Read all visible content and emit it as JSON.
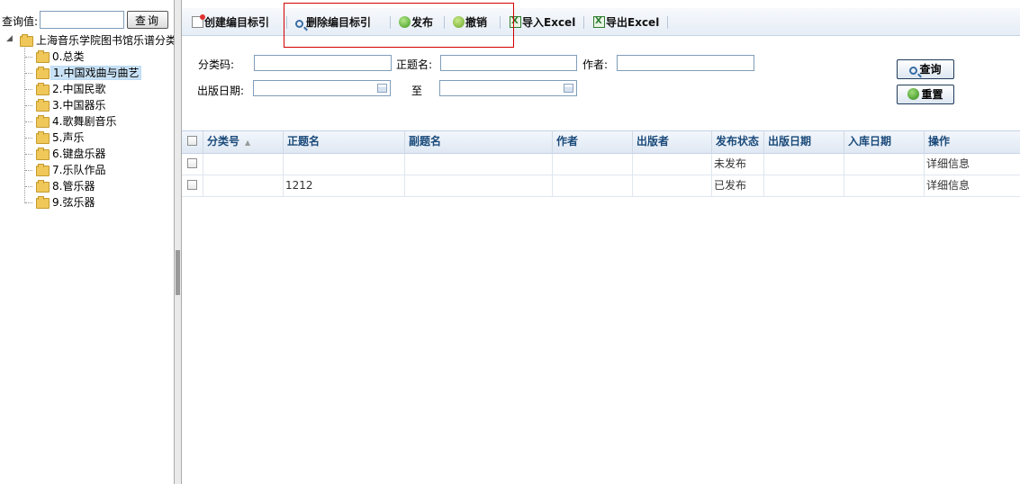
{
  "left": {
    "search_label": "查询值:",
    "search_value": "",
    "search_button": "查询",
    "tree_root": "上海音乐学院图书馆乐谱分类",
    "tree_items": [
      "0.总类",
      "1.中国戏曲与曲艺",
      "2.中国民歌",
      "3.中国器乐",
      "4.歌舞剧音乐",
      "5.声乐",
      "6.键盘乐器",
      "7.乐队作品",
      "8.管乐器",
      "9.弦乐器"
    ]
  },
  "toolbar": {
    "create": "创建编目标引",
    "delete": "删除编目标引",
    "publish": "发布",
    "revoke": "撤销",
    "import": "导入Excel",
    "export": "导出Excel"
  },
  "form": {
    "class_code_label": "分类码:",
    "title_label": "正题名:",
    "author_label": "作者:",
    "pub_date_label": "出版日期:",
    "to_label": "至",
    "query_button": "查询",
    "reset_button": "重置"
  },
  "grid": {
    "headers": [
      "分类号",
      "正题名",
      "副题名",
      "作者",
      "出版者",
      "发布状态",
      "出版日期",
      "入库日期",
      "操作"
    ],
    "rows": [
      {
        "class_no": "",
        "title": "",
        "subtitle": "",
        "author": "",
        "publisher": "",
        "status": "未发布",
        "pub_date": "",
        "store_date": "",
        "action": "详细信息"
      },
      {
        "class_no": "",
        "title": "1212",
        "subtitle": "",
        "author": "",
        "publisher": "",
        "status": "已发布",
        "pub_date": "",
        "store_date": "",
        "action": "详细信息"
      }
    ]
  },
  "colors": {
    "highlight_box": "#d40000",
    "header_text": "#1a4a7a",
    "selected_node": "#c9e2f6"
  }
}
